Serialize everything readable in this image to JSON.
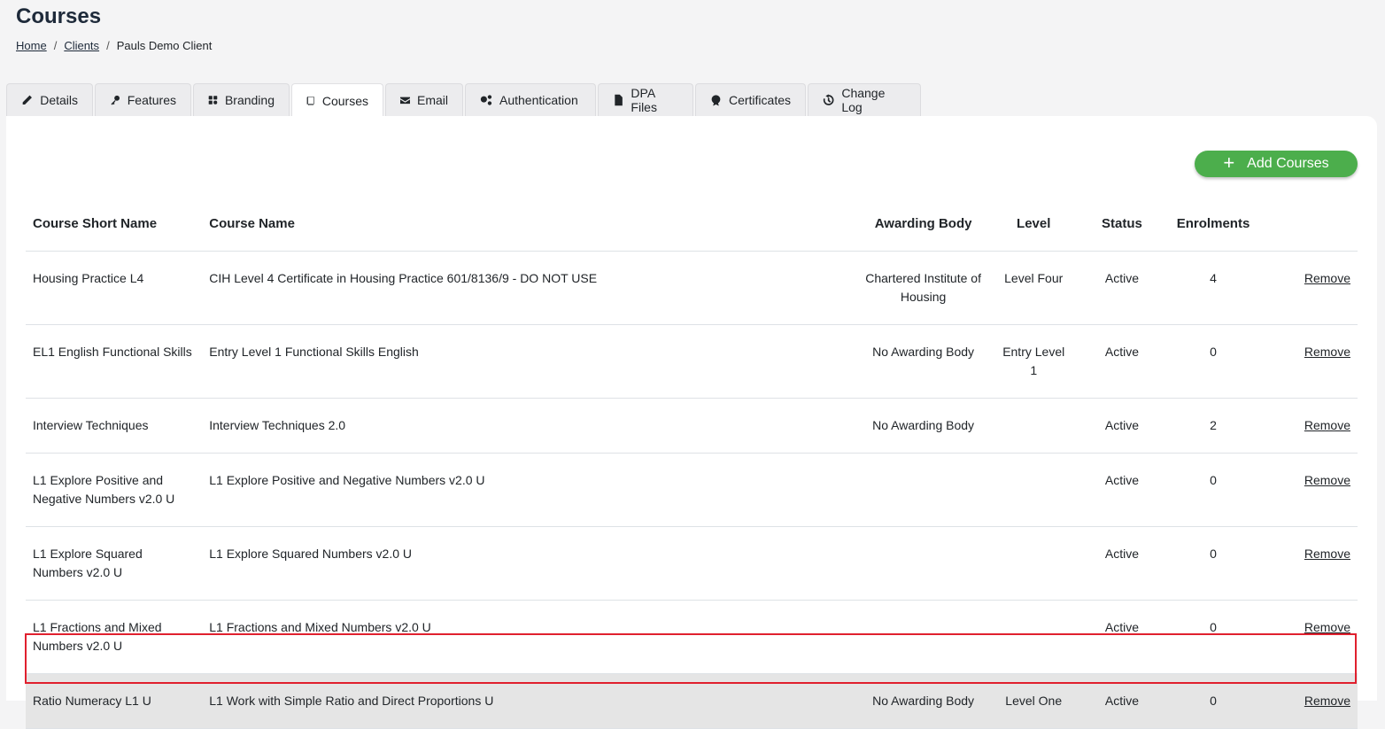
{
  "page": {
    "title": "Courses"
  },
  "breadcrumb": [
    {
      "label": "Home"
    },
    {
      "label": "Clients"
    },
    {
      "label": "Pauls Demo Client"
    }
  ],
  "tabs": [
    {
      "label": "Details",
      "icon": "pencil-icon"
    },
    {
      "label": "Features",
      "icon": "key-icon"
    },
    {
      "label": "Branding",
      "icon": "palette-icon"
    },
    {
      "label": "Courses",
      "icon": "book-icon",
      "active": true
    },
    {
      "label": "Email",
      "icon": "envelope-icon"
    },
    {
      "label": "Authentication",
      "icon": "cogs-icon"
    },
    {
      "label": "DPA Files",
      "icon": "file-icon"
    },
    {
      "label": "Certificates",
      "icon": "certificate-icon"
    },
    {
      "label": "Change Log",
      "icon": "history-icon"
    }
  ],
  "toolbar": {
    "add_label": "Add Courses",
    "add_color": "#4cae4c"
  },
  "table": {
    "headers": [
      "Course Short Name",
      "Course Name",
      "Awarding Body",
      "Level",
      "Status",
      "Enrolments",
      ""
    ],
    "rows": [
      {
        "short": "Housing Practice L4",
        "name": "CIH Level 4 Certificate in Housing Practice 601/8136/9 - DO NOT USE",
        "body": "Chartered Institute of Housing",
        "level": "Level Four",
        "status": "Active",
        "enrolments": "4",
        "action": "Remove"
      },
      {
        "short": "EL1 English Functional Skills",
        "name": "Entry Level 1 Functional Skills English",
        "body": "No Awarding Body",
        "level": "Entry Level 1",
        "status": "Active",
        "enrolments": "0",
        "action": "Remove"
      },
      {
        "short": "Interview Techniques",
        "name": "Interview Techniques 2.0",
        "body": "No Awarding Body",
        "level": "",
        "status": "Active",
        "enrolments": "2",
        "action": "Remove"
      },
      {
        "short": "L1 Explore Positive and Negative Numbers v2.0 U",
        "name": "L1 Explore Positive and Negative Numbers v2.0 U",
        "body": "",
        "level": "",
        "status": "Active",
        "enrolments": "0",
        "action": "Remove"
      },
      {
        "short": "L1 Explore Squared Numbers v2.0 U",
        "name": "L1 Explore Squared Numbers v2.0 U",
        "body": "",
        "level": "",
        "status": "Active",
        "enrolments": "0",
        "action": "Remove"
      },
      {
        "short": "L1 Fractions and Mixed Numbers v2.0 U",
        "name": "L1 Fractions and Mixed Numbers v2.0 U",
        "body": "",
        "level": "",
        "status": "Active",
        "enrolments": "0",
        "action": "Remove"
      },
      {
        "short": "Ratio Numeracy L1 U",
        "name": "L1 Work with Simple Ratio and Direct Proportions U",
        "body": "No Awarding Body",
        "level": "Level One",
        "status": "Active",
        "enrolments": "0",
        "action": "Remove",
        "highlighted": true
      }
    ]
  },
  "colors": {
    "highlight_border": "#e0202e",
    "highlight_row": "#e5e5e5"
  }
}
